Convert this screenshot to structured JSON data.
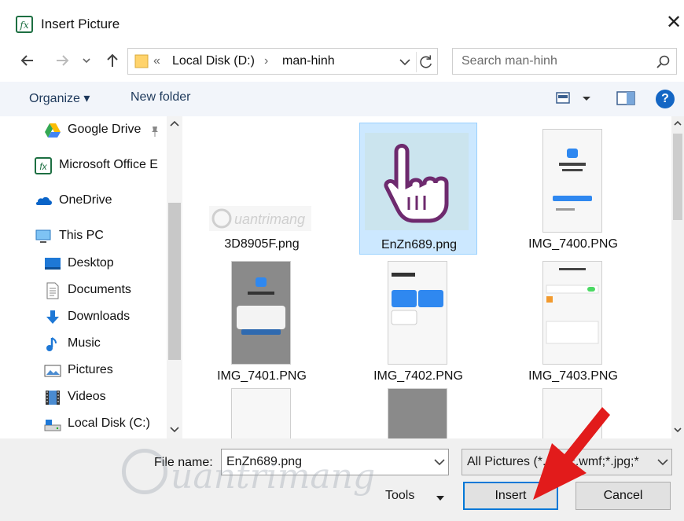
{
  "window": {
    "title": "Insert Picture"
  },
  "navigation": {
    "breadcrumb_prefix": "«",
    "breadcrumbs": [
      "Local Disk (D:)",
      "man-hinh"
    ],
    "breadcrumb_sep": "›",
    "search_placeholder": "Search man-hinh"
  },
  "toolbar": {
    "organize_label": "Organize",
    "new_folder_label": "New folder",
    "help_label": "?"
  },
  "sidebar": {
    "items": [
      {
        "label": "Google Drive",
        "icon": "google-drive-icon"
      },
      {
        "label": "Microsoft Office E",
        "icon": "excel-icon"
      },
      {
        "label": "OneDrive",
        "icon": "onedrive-icon"
      },
      {
        "label": "This PC",
        "icon": "this-pc-icon"
      },
      {
        "label": "Desktop",
        "icon": "desktop-icon"
      },
      {
        "label": "Documents",
        "icon": "documents-icon"
      },
      {
        "label": "Downloads",
        "icon": "downloads-icon"
      },
      {
        "label": "Music",
        "icon": "music-icon"
      },
      {
        "label": "Pictures",
        "icon": "pictures-icon"
      },
      {
        "label": "Videos",
        "icon": "videos-icon"
      },
      {
        "label": "Local Disk (C:)",
        "icon": "local-disk-icon"
      }
    ]
  },
  "files": [
    {
      "name": "3D8905F.png"
    },
    {
      "name": "EnZn689.png",
      "selected": true
    },
    {
      "name": "IMG_7400.PNG"
    },
    {
      "name": "IMG_7401.PNG"
    },
    {
      "name": "IMG_7402.PNG"
    },
    {
      "name": "IMG_7403.PNG"
    }
  ],
  "footer": {
    "file_name_label": "File name:",
    "file_name_value": "EnZn689.png",
    "file_type_value": "All Pictures (*.emf;*.wmf;*.jpg;*",
    "tools_label": "Tools",
    "insert_label": "Insert",
    "cancel_label": "Cancel"
  },
  "watermark": {
    "text": "uantrimang"
  },
  "colors": {
    "accent": "#0078d7",
    "selection": "#cce8ff",
    "arrow": "#e21b1b",
    "help": "#1466c4"
  }
}
